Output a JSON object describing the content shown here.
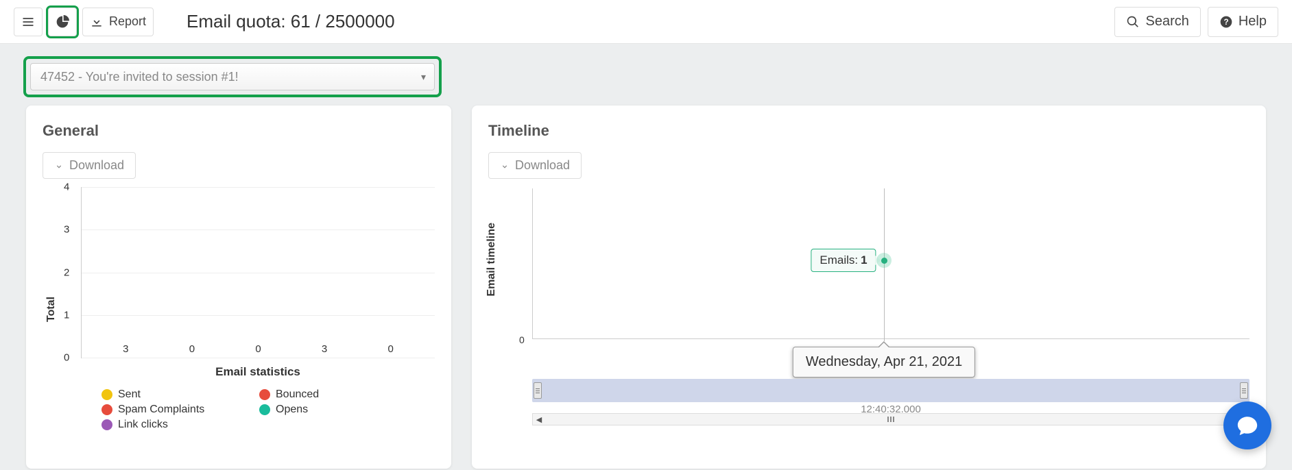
{
  "topbar": {
    "report_label": "Report",
    "quota_text": "Email quota: 61 / 2500000",
    "search_label": "Search",
    "help_label": "Help"
  },
  "dropdown": {
    "selected": "47452 - You're invited to session #1!"
  },
  "general": {
    "title": "General",
    "download_label": "Download",
    "xlabel": "Email statistics",
    "ylabel": "Total"
  },
  "timeline": {
    "title": "Timeline",
    "download_label": "Download",
    "ylabel": "Email timeline",
    "ytick0": "0",
    "badge_prefix": "Emails:",
    "badge_value": "1",
    "tooltip_date": "Wednesday, Apr 21, 2021",
    "nav_time": "12:40:32.000"
  },
  "chart_data": {
    "type": "bar",
    "title": "Email statistics",
    "xlabel": "Email statistics",
    "ylabel": "Total",
    "ylim": [
      0,
      4
    ],
    "yticks": [
      0,
      1,
      2,
      3,
      4
    ],
    "series": [
      {
        "name": "Sent",
        "value": 3,
        "color": "#f1c40f"
      },
      {
        "name": "Bounced",
        "value": 0,
        "color": "#e74c3c"
      },
      {
        "name": "Spam Complaints",
        "value": 0,
        "color": "#e74c3c"
      },
      {
        "name": "Opens",
        "value": 3,
        "color": "#1abc9c"
      },
      {
        "name": "Link clicks",
        "value": 0,
        "color": "#9b59b6"
      }
    ],
    "legend_order": [
      "Sent",
      "Bounced",
      "Spam Complaints",
      "Opens",
      "Link clicks"
    ]
  }
}
